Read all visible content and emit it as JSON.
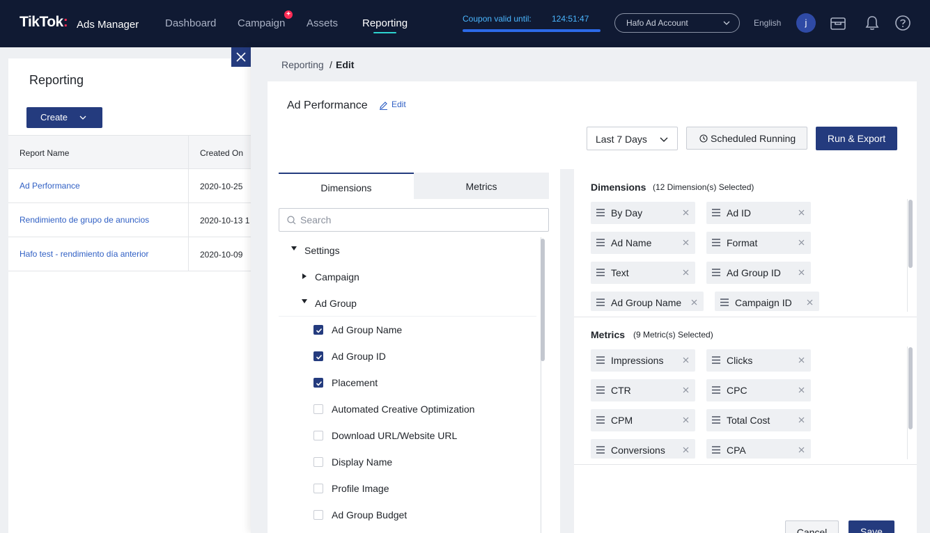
{
  "topnav": {
    "logo": "TikTok",
    "logo_sub": "Ads Manager",
    "items": [
      "Dashboard",
      "Campaign",
      "Assets",
      "Reporting"
    ],
    "campaign_badge": "+",
    "coupon_label": "Coupon valid until:",
    "coupon_time": "124:51:47",
    "account": "Hafo Ad Account",
    "language": "English",
    "avatar_initial": "j",
    "icons": [
      "briefcase-icon",
      "bell-icon",
      "help-icon"
    ],
    "accent_color": "#2dd4d0"
  },
  "left": {
    "title": "Reporting",
    "create_label": "Create",
    "columns": [
      "Report Name",
      "Created On"
    ],
    "rows": [
      {
        "name": "Ad Performance",
        "date": "2020-10-25"
      },
      {
        "name": "Rendimiento de grupo de anuncios",
        "date": "2020-10-13 1"
      },
      {
        "name": "Hafo test - rendimiento día anterior",
        "date": "2020-10-09"
      }
    ]
  },
  "drawer": {
    "breadcrumb_root": "Reporting",
    "breadcrumb_sep": "/",
    "breadcrumb_current": "Edit",
    "report_title": "Ad Performance",
    "edit_label": "Edit",
    "date_range": "Last 7 Days",
    "scheduled_label": "Scheduled Running",
    "run_label": "Run & Export",
    "tabs": [
      "Dimensions",
      "Metrics"
    ],
    "search_placeholder": "Search",
    "tree": [
      {
        "label": "Settings",
        "type": "group",
        "expanded": true
      },
      {
        "label": "Campaign",
        "type": "group",
        "expanded": false
      },
      {
        "label": "Ad Group",
        "type": "group",
        "expanded": true
      },
      {
        "label": "Ad Group Name",
        "type": "item",
        "checked": true
      },
      {
        "label": "Ad Group ID",
        "type": "item",
        "checked": true
      },
      {
        "label": "Placement",
        "type": "item",
        "checked": true
      },
      {
        "label": "Automated Creative Optimization",
        "type": "item",
        "checked": false
      },
      {
        "label": "Download URL/Website URL",
        "type": "item",
        "checked": false
      },
      {
        "label": "Display Name",
        "type": "item",
        "checked": false
      },
      {
        "label": "Profile Image",
        "type": "item",
        "checked": false
      },
      {
        "label": "Ad Group Budget",
        "type": "item",
        "checked": false
      }
    ],
    "dimensions_title": "Dimensions",
    "dimensions_count": "(12 Dimension(s) Selected)",
    "dimensions": [
      "By Day",
      "Ad ID",
      "Ad Name",
      "Format",
      "Text",
      "Ad Group ID",
      "Ad Group Name",
      "Campaign ID"
    ],
    "metrics_title": "Metrics",
    "metrics_count": "(9 Metric(s) Selected)",
    "metrics": [
      "Impressions",
      "Clicks",
      "CTR",
      "CPC",
      "CPM",
      "Total Cost",
      "Conversions",
      "CPA"
    ],
    "cancel_label": "Cancel",
    "save_label": "Save",
    "primary_color": "#243b7e"
  }
}
